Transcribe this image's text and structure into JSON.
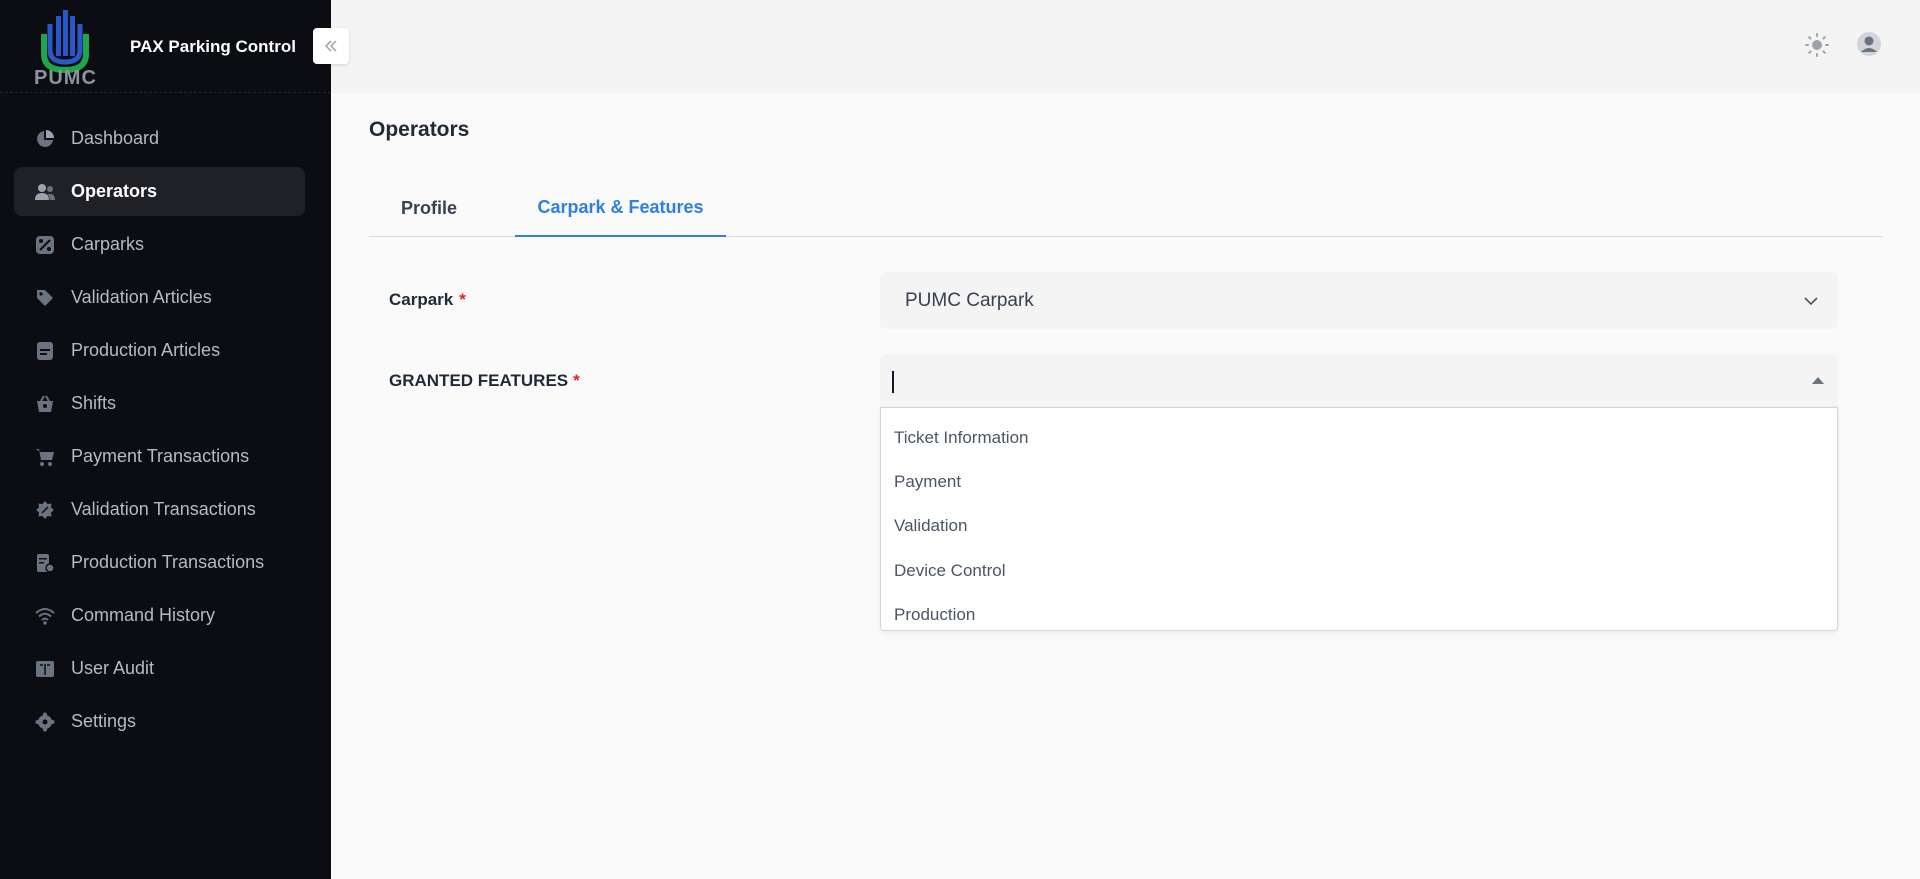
{
  "app": {
    "name": "PAX Parking Control",
    "logo_text": "PUMC"
  },
  "sidebar": {
    "items": [
      {
        "label": "Dashboard",
        "icon": "pie-chart-icon"
      },
      {
        "label": "Operators",
        "icon": "users-icon",
        "active": true
      },
      {
        "label": "Carparks",
        "icon": "percent-badge-icon"
      },
      {
        "label": "Validation Articles",
        "icon": "tag-icon"
      },
      {
        "label": "Production Articles",
        "icon": "ticket-icon"
      },
      {
        "label": "Shifts",
        "icon": "basket-icon"
      },
      {
        "label": "Payment Transactions",
        "icon": "cart-icon"
      },
      {
        "label": "Validation Transactions",
        "icon": "discount-icon"
      },
      {
        "label": "Production Transactions",
        "icon": "receipt-icon"
      },
      {
        "label": "Command History",
        "icon": "wifi-icon"
      },
      {
        "label": "User Audit",
        "icon": "book-icon"
      },
      {
        "label": "Settings",
        "icon": "gear-icon"
      }
    ]
  },
  "page": {
    "title": "Operators"
  },
  "tabs": [
    {
      "label": "Profile",
      "active": false
    },
    {
      "label": "Carpark & Features",
      "active": true
    }
  ],
  "form": {
    "carpark": {
      "label": "Carpark",
      "required_mark": "*",
      "value": "PUMC Carpark"
    },
    "features": {
      "label": "GRANTED FEATURES",
      "required_mark": "*",
      "value": "",
      "options": [
        "Ticket Information",
        "Payment",
        "Validation",
        "Device Control",
        "Production"
      ]
    }
  },
  "colors": {
    "accent": "#2f7fe0",
    "sidebar_bg": "#0b0d12",
    "required": "#e02424"
  }
}
